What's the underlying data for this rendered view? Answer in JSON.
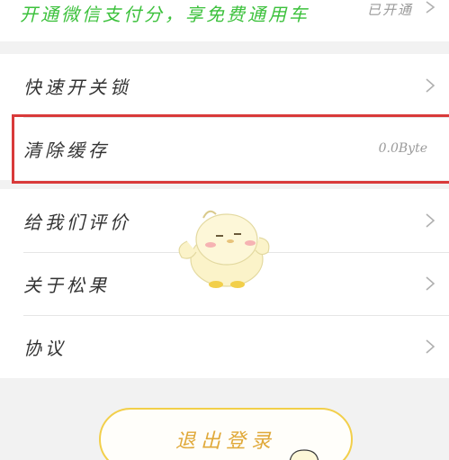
{
  "wechat_banner": {
    "promo_text": "开通微信支付分，享免费通用车",
    "status_text": "已开通"
  },
  "settings": {
    "items": [
      {
        "label": "快速开关锁",
        "value": ""
      },
      {
        "label": "清除缓存",
        "value": "0.0Byte"
      },
      {
        "label": "给我们评价",
        "value": ""
      },
      {
        "label": "关于松果",
        "value": ""
      },
      {
        "label": "协议",
        "value": ""
      }
    ]
  },
  "logout_label": "退出登录",
  "colors": {
    "accent_green": "#3cc13c",
    "highlight_red": "#d93a3a",
    "logout_yellow": "#f2cf4a"
  }
}
